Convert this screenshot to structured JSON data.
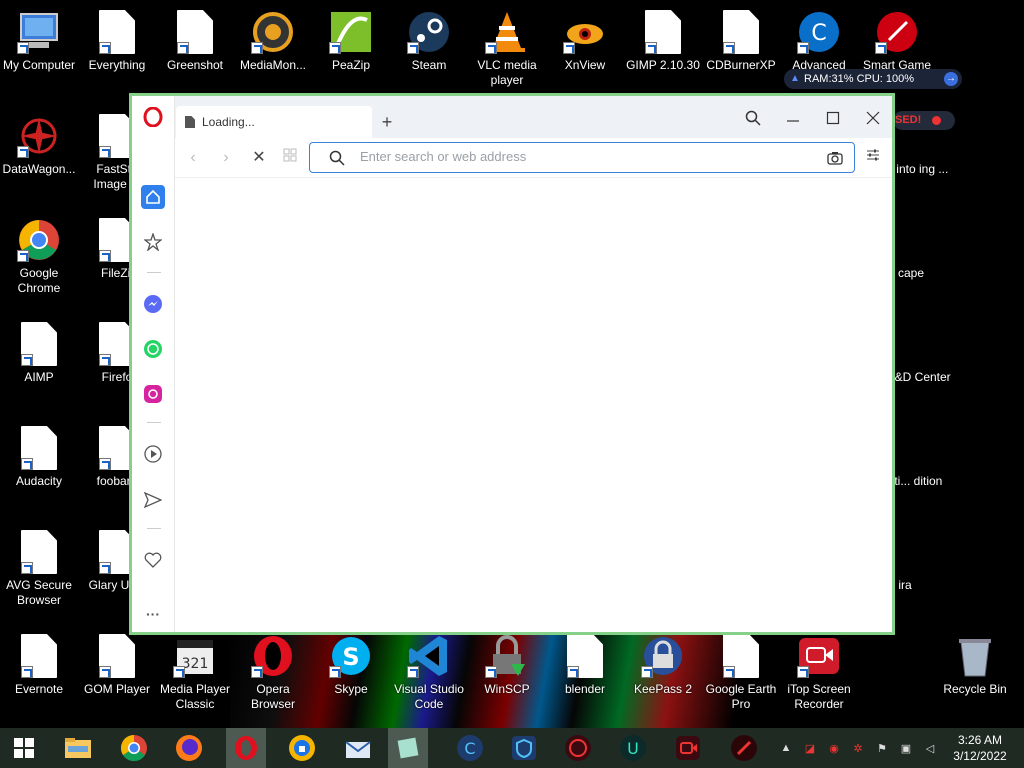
{
  "desktop": {
    "icons": [
      {
        "label": "My Computer"
      },
      {
        "label": "Everything"
      },
      {
        "label": "Greenshot"
      },
      {
        "label": "MediaMon..."
      },
      {
        "label": "PeaZip"
      },
      {
        "label": "Steam"
      },
      {
        "label": "VLC media player"
      },
      {
        "label": "XnView"
      },
      {
        "label": "GIMP 2.10.30"
      },
      {
        "label": "CDBurnerXP"
      },
      {
        "label": "Advanced"
      },
      {
        "label": "Smart Game"
      },
      {
        "label": "DataWagon..."
      },
      {
        "label": "FastSto Image Vi"
      },
      {
        "label": "Google Chrome"
      },
      {
        "label": "FileZil"
      },
      {
        "label": "AIMP"
      },
      {
        "label": "Firefo"
      },
      {
        "label": "Audacity"
      },
      {
        "label": "foobar2"
      },
      {
        "label": "AVG Secure Browser"
      },
      {
        "label": "Glary Uti 5"
      },
      {
        "label": "Evernote"
      },
      {
        "label": "GOM Player"
      },
      {
        "label": "Media Player Classic"
      },
      {
        "label": "Opera Browser"
      },
      {
        "label": "Skype"
      },
      {
        "label": "Visual Studio Code"
      },
      {
        "label": "WinSCP"
      },
      {
        "label": "blender"
      },
      {
        "label": "KeePass 2"
      },
      {
        "label": "Google Earth Pro"
      },
      {
        "label": "iTop Screen Recorder"
      },
      {
        "label": "Recycle Bin"
      },
      {
        "label": "t into ing ..."
      },
      {
        "label": "cape"
      },
      {
        "label": "t-S&D Center"
      },
      {
        "label": "Anti... dition"
      },
      {
        "label": "ira"
      }
    ]
  },
  "widgets": {
    "sysmon_text": "RAM:31%  CPU: 100%",
    "paused_text": "SED!"
  },
  "browser": {
    "tab_title": "Loading...",
    "new_tab": "+",
    "address_placeholder": "Enter search or web address",
    "address_value": ""
  },
  "taskbar": {
    "time": "3:26 AM",
    "date": "3/12/2022"
  },
  "colors": {
    "desktop_bg": "#000000",
    "window_border": "#85d18a",
    "accent": "#3b82d6",
    "opera_red": "#e0101e"
  }
}
